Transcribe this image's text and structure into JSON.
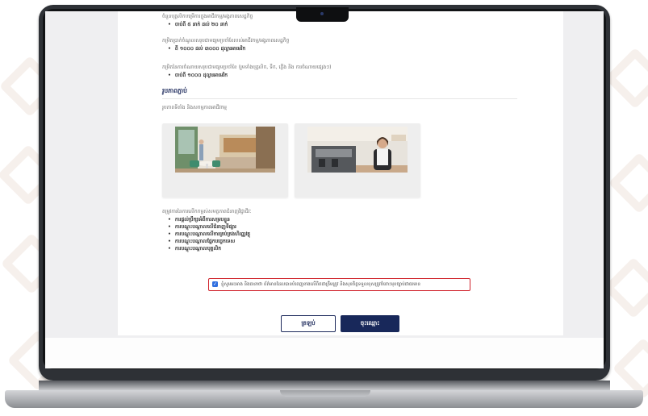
{
  "form": {
    "line1": "ចំនួនបុគ្គលិកបម្រើការក្នុងអាជីវកម្ម/អង្គភាពសេដ្ឋកិច្ច",
    "line1_value": "ចាប់ពី ៥ នាក់ ដល់ ២០ នាក់",
    "line2": "កម្រិតប្រាក់ចំណូលសរុបជាមធ្យមប្រចាំខែរបស់អាជីវកម្ម/អង្គភាពសេដ្ឋកិច្ច",
    "line2_value": "ពី ១០០០ ដល់ ៣០០០ ដុល្លារអាមេរិក",
    "line3": "កម្រិតនៃការចំណាយសរុបជាមធ្យមប្រចាំខែ (រួមទាំងបុគ្គលិក, ទឹក, ភ្លើង និង ការចំណាយផ្សេងៗ)",
    "line3_value": "ចាប់ពី ១០០០ ដុល្លារអាមេរិក",
    "section_title": "រូបភាពភ្ជាប់",
    "section_subtitle": "រូបភាពទីតាំង និងសកម្មភាពអាជីវកម្ម",
    "needs_label": "តម្រូវការនៃការលើកកម្ពស់សមត្ថភាពជំនាញវិជ្ជាជីវៈ",
    "needs": [
      "ការផ្តល់ប្រឹក្សាអំពីការសម្របខ្លួន",
      "ការបណ្តុះបណ្តាលលើជំនាញទីផ្សារ",
      "ការបណ្តុះបណ្តាលលើការគ្រប់គ្រងហិរញ្ញវត្ថុ",
      "ការបណ្តុះបណ្តាលផ្នែកបច្ចេកទេស",
      "ការបណ្តុះបណ្តាលបុគ្គលិក"
    ],
    "agreement": "ខ្ញុំសូមអះអាង និងធានាថា ព័ត៌មានដែលបានបំពេញខាងលើពិតជាត្រឹមត្រូវ និងសុខចិត្តទទួលខុសត្រូវចំពោះមុខច្បាប់ជាធរមាន",
    "back_label": "ត្រឡប់",
    "submit_label": "ចុះឈ្មោះ"
  },
  "colors": {
    "accent": "#18285a",
    "checkbox": "#2f6fe0",
    "highlight": "#d0232b"
  }
}
